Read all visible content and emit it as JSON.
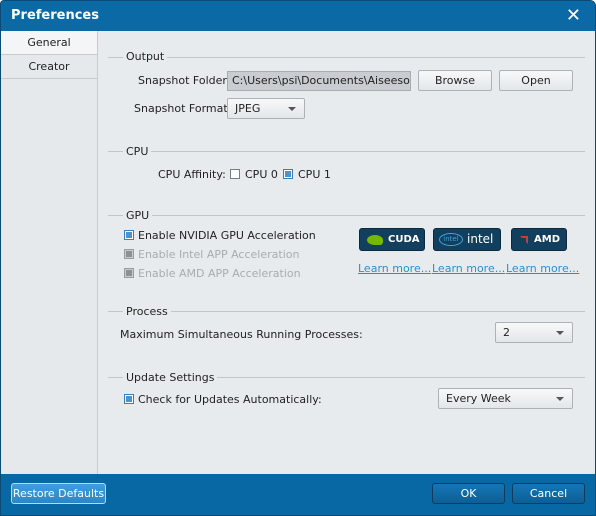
{
  "window": {
    "title": "Preferences"
  },
  "sidebar": {
    "tabs": [
      {
        "label": "General"
      },
      {
        "label": "Creator"
      }
    ]
  },
  "output": {
    "title": "Output",
    "snapshot_folder_label": "Snapshot Folder:",
    "snapshot_folder_value": "C:\\Users\\psi\\Documents\\Aiseesoft Studio\\Snapshot",
    "browse_label": "Browse",
    "open_label": "Open",
    "snapshot_format_label": "Snapshot Format:",
    "snapshot_format_value": "JPEG"
  },
  "cpu": {
    "title": "CPU",
    "affinity_label": "CPU Affinity:",
    "cpu0": {
      "label": "CPU 0",
      "checked": false
    },
    "cpu1": {
      "label": "CPU 1",
      "checked": true
    }
  },
  "gpu": {
    "title": "GPU",
    "options": [
      {
        "label": "Enable NVIDIA GPU Acceleration",
        "checked": true,
        "enabled": true
      },
      {
        "label": "Enable Intel APP Acceleration",
        "checked": false,
        "enabled": false
      },
      {
        "label": "Enable AMD APP Acceleration",
        "checked": false,
        "enabled": false
      }
    ],
    "badges": [
      {
        "label": "CUDA"
      },
      {
        "label": "intel"
      },
      {
        "label": "AMD"
      }
    ],
    "learn_more": "Learn more..."
  },
  "process": {
    "title": "Process",
    "max_label": "Maximum Simultaneous Running Processes:",
    "max_value": "2"
  },
  "update": {
    "title": "Update Settings",
    "check_label": "Check for Updates Automatically:",
    "checked": true,
    "frequency_value": "Every Week"
  },
  "footer": {
    "restore_label": "Restore Defaults",
    "ok_label": "OK",
    "cancel_label": "Cancel"
  }
}
